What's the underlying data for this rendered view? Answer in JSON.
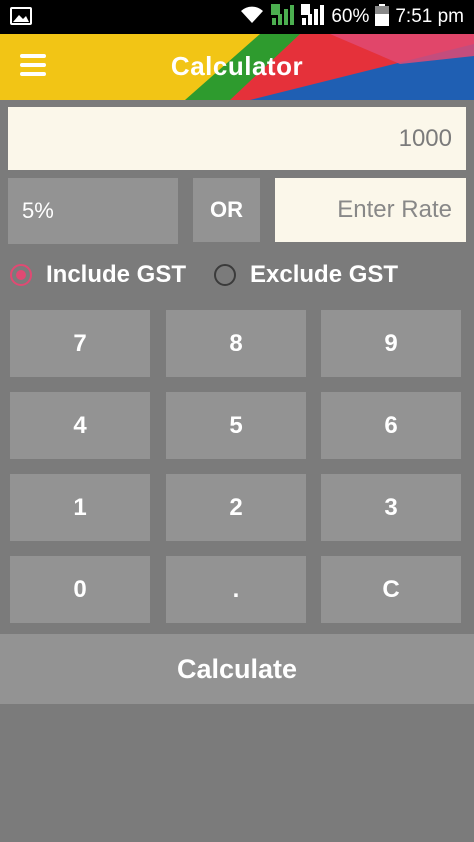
{
  "status_bar": {
    "battery": "60%",
    "time": "7:51 pm",
    "sim1": "1",
    "sim2": "2",
    "icons": [
      "image-notification-icon",
      "wifi-icon",
      "signal-sim1-icon",
      "signal-sim2-icon",
      "battery-icon"
    ]
  },
  "header": {
    "title": "Calculator",
    "menu_icon": "hamburger-menu-icon",
    "colors": {
      "yellow": "#f2c515",
      "green": "#2e9b2e",
      "red": "#e5313a",
      "blue": "#1f5fb3",
      "pink": "#e04a73"
    }
  },
  "amount": {
    "value": "1000"
  },
  "rate": {
    "selected": "5%",
    "or_label": "OR",
    "input_placeholder": "Enter Rate"
  },
  "gst_options": [
    {
      "label": "Include GST",
      "checked": true
    },
    {
      "label": "Exclude GST",
      "checked": false
    }
  ],
  "keypad": {
    "keys": [
      "7",
      "8",
      "9",
      "4",
      "5",
      "6",
      "1",
      "2",
      "3",
      "0",
      ".",
      "C"
    ]
  },
  "calculate_label": "Calculate",
  "colors": {
    "background": "#7b7b7b",
    "key": "#939393",
    "field": "#fbf7ea",
    "accent": "#e04a73"
  }
}
